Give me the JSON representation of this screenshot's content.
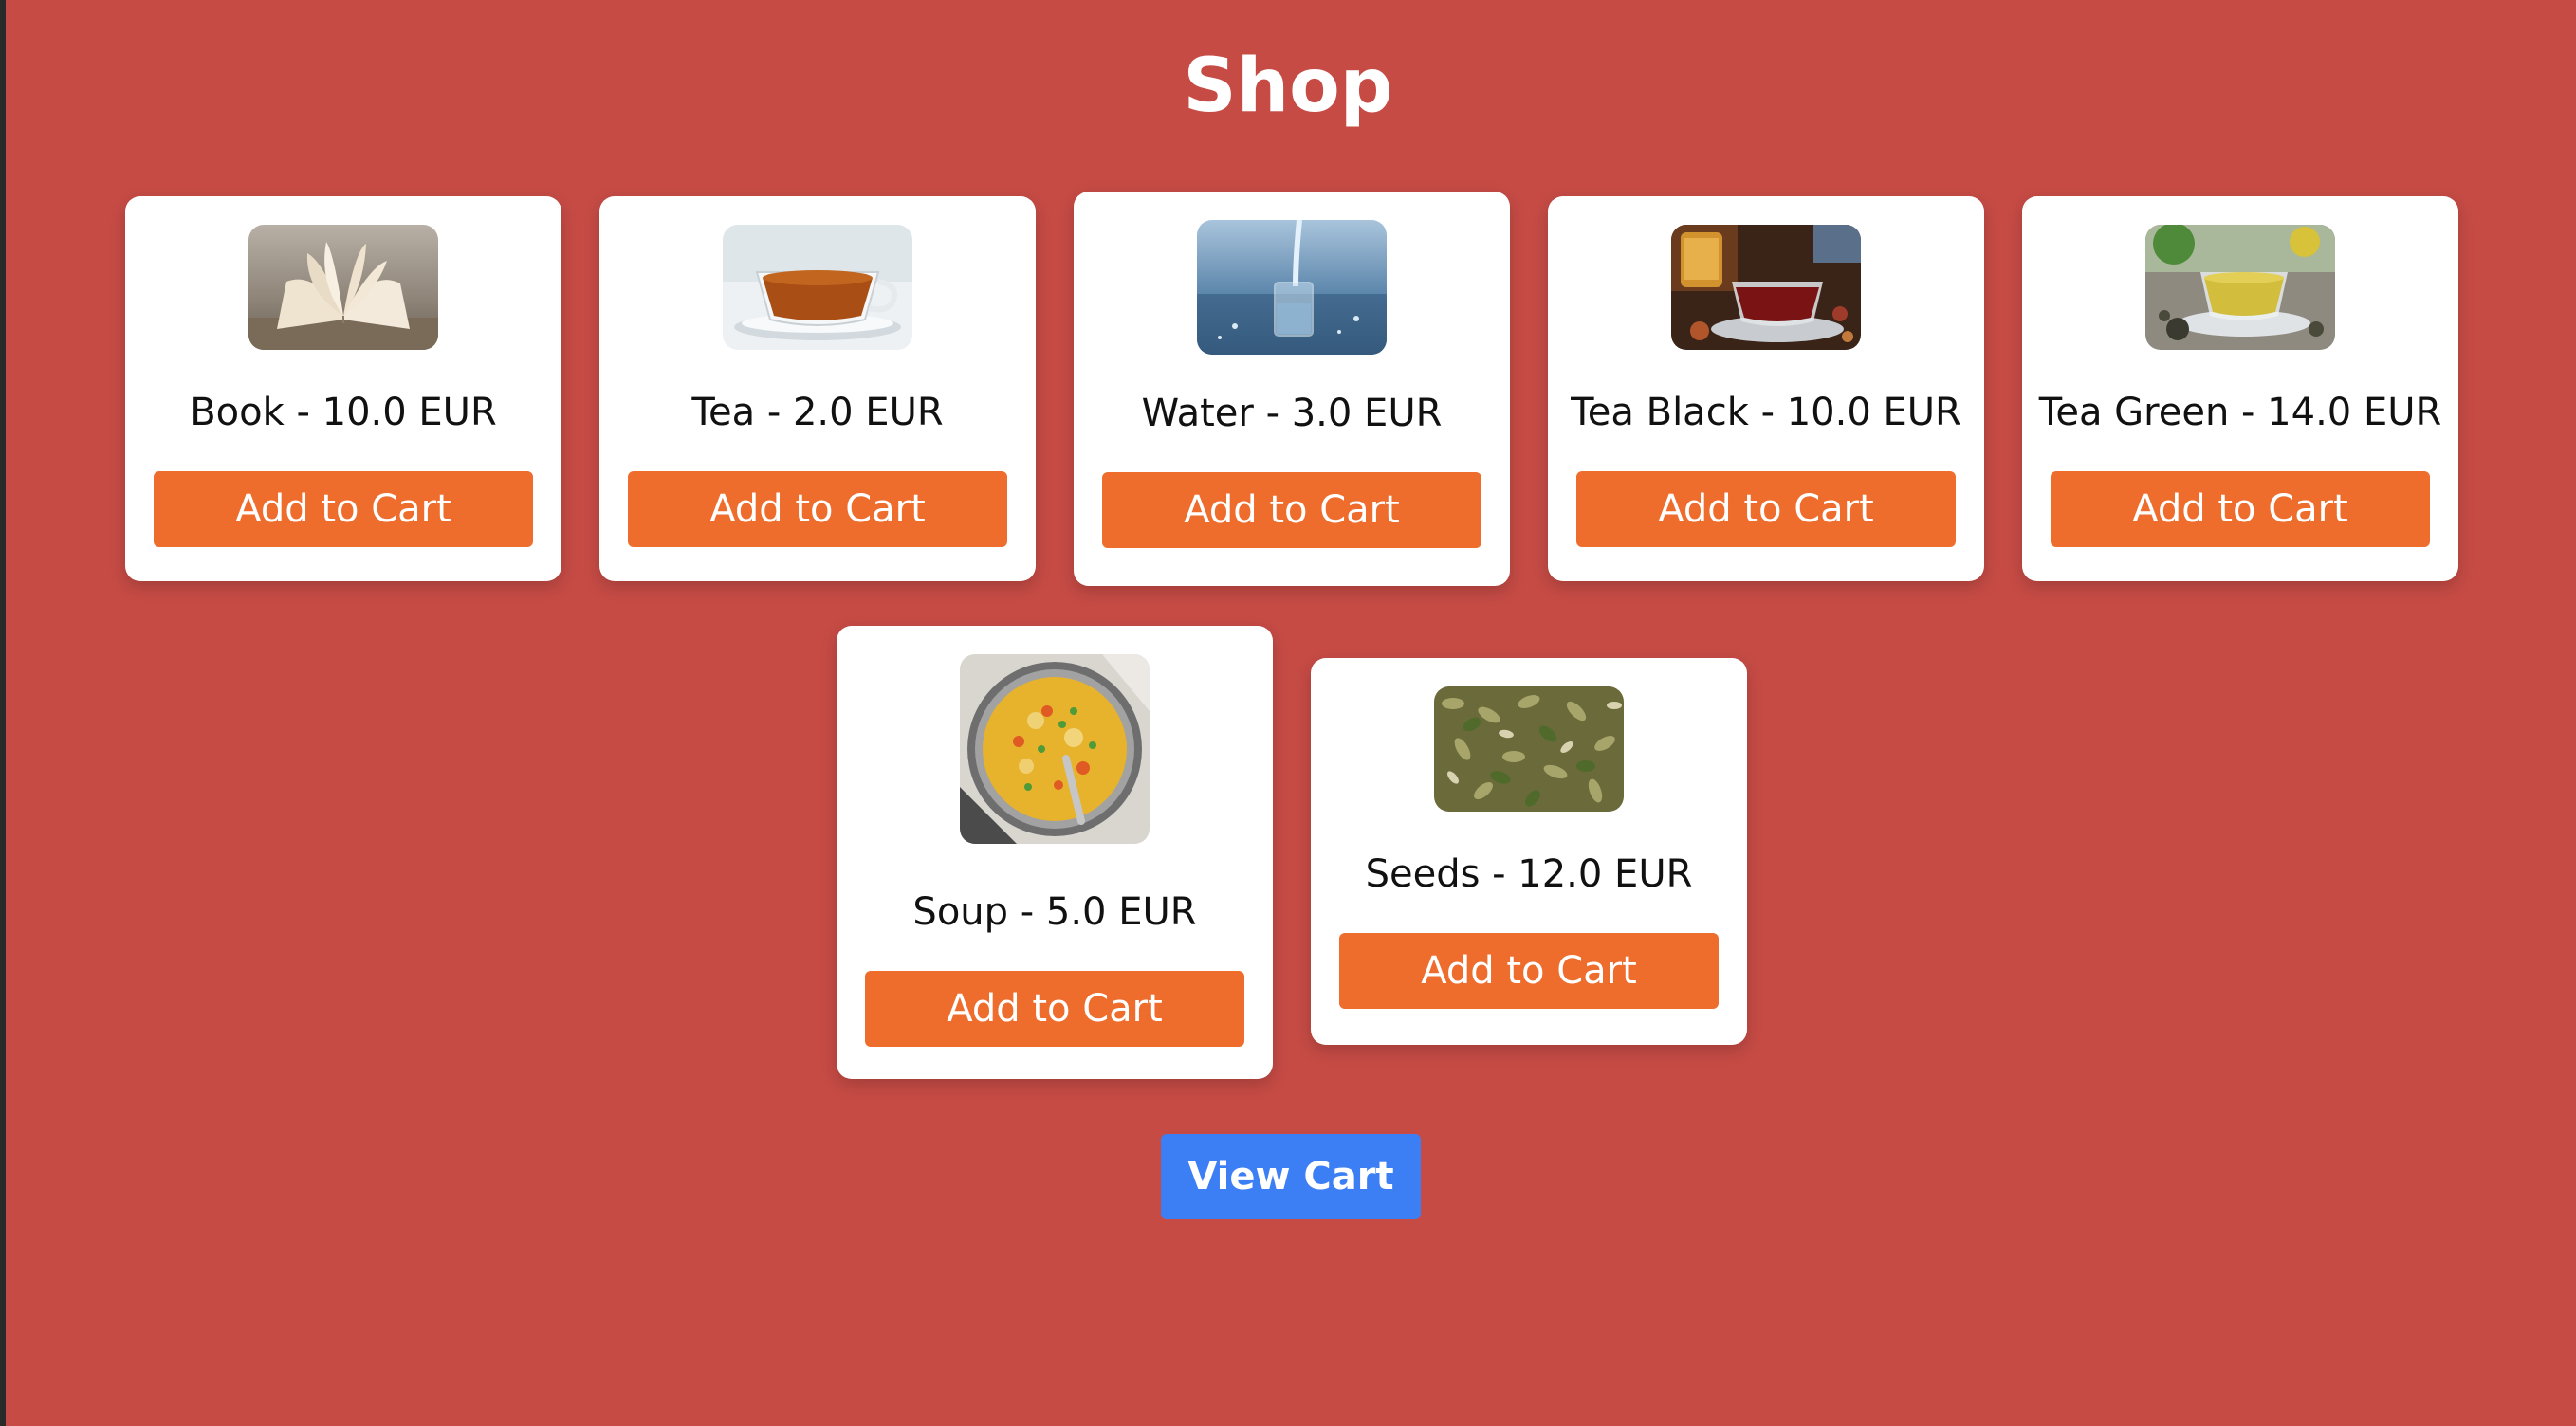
{
  "page": {
    "title": "Shop",
    "background_color": "#c64b45"
  },
  "products": [
    {
      "name": "Book",
      "label": "Book - 10.0 EUR",
      "price": 10.0,
      "currency": "EUR",
      "image_icon": "open-book-photo",
      "button_label": "Add to Cart"
    },
    {
      "name": "Tea",
      "label": "Tea - 2.0 EUR",
      "price": 2.0,
      "currency": "EUR",
      "image_icon": "tea-cup-photo",
      "button_label": "Add to Cart"
    },
    {
      "name": "Water",
      "label": "Water - 3.0 EUR",
      "price": 3.0,
      "currency": "EUR",
      "image_icon": "water-glass-photo",
      "button_label": "Add to Cart"
    },
    {
      "name": "Tea Black",
      "label": "Tea Black - 10.0 EUR",
      "price": 10.0,
      "currency": "EUR",
      "image_icon": "black-tea-photo",
      "button_label": "Add to Cart"
    },
    {
      "name": "Tea Green",
      "label": "Tea Green - 14.0 EUR",
      "price": 14.0,
      "currency": "EUR",
      "image_icon": "green-tea-photo",
      "button_label": "Add to Cart"
    },
    {
      "name": "Soup",
      "label": "Soup - 5.0 EUR",
      "price": 5.0,
      "currency": "EUR",
      "image_icon": "soup-bowl-photo",
      "button_label": "Add to Cart"
    },
    {
      "name": "Seeds",
      "label": "Seeds - 12.0 EUR",
      "price": 12.0,
      "currency": "EUR",
      "image_icon": "seeds-photo",
      "button_label": "Add to Cart"
    }
  ],
  "cart": {
    "view_label": "View Cart"
  },
  "colors": {
    "add_button": "#ee6d2d",
    "view_cart_button": "#3c7ff5",
    "card": "#ffffff"
  }
}
